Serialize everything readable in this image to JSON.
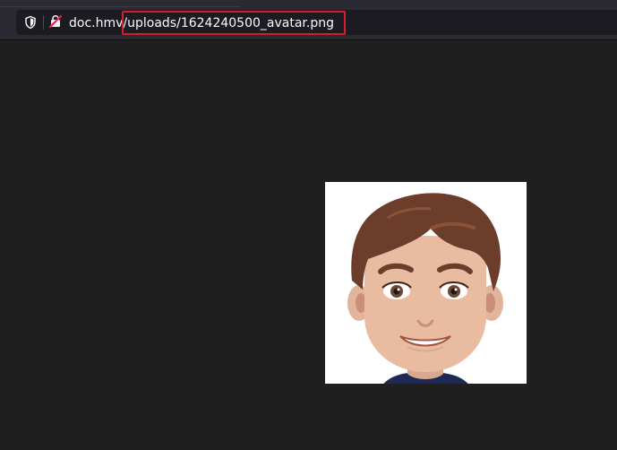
{
  "address_bar": {
    "domain": "doc.hmv",
    "path": "/uploads/1624240500_avatar.png"
  },
  "icons": {
    "tracking_protection": "shield-icon",
    "site_identity": "site-identity-icon"
  },
  "content": {
    "image": "avatar-image"
  },
  "colors": {
    "highlight": "#d4202a",
    "page_background": "#1f1f1f"
  }
}
